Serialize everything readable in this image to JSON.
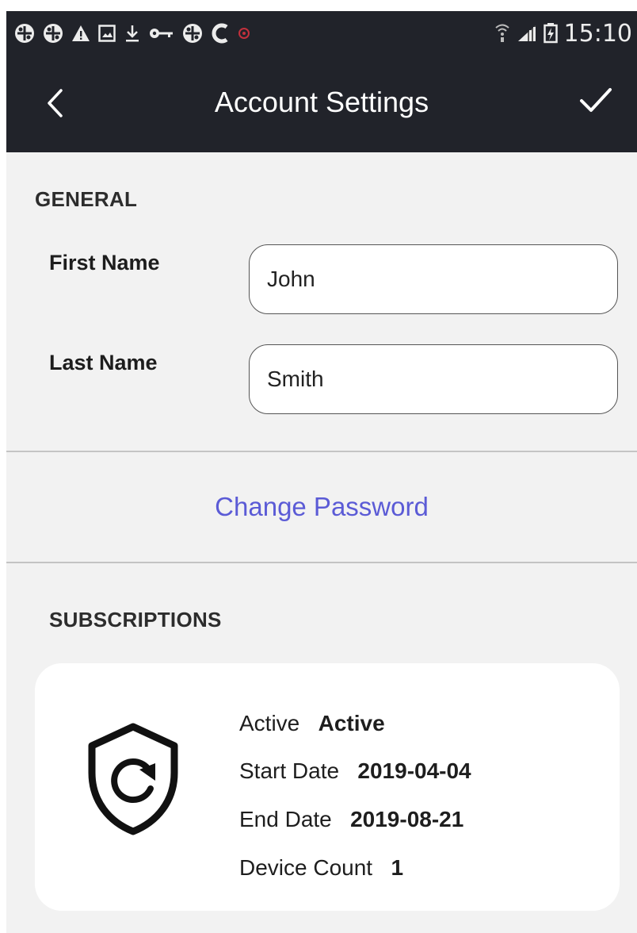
{
  "status_bar": {
    "left_icons": [
      "app-icon",
      "app-icon",
      "warning-icon",
      "image-icon",
      "download-icon",
      "key-icon",
      "app-icon",
      "c-icon",
      "notification-icon"
    ],
    "time": "15:10"
  },
  "app_bar": {
    "title": "Account Settings"
  },
  "general": {
    "heading": "GENERAL",
    "first_name_label": "First Name",
    "first_name_value": "John",
    "last_name_label": "Last Name",
    "last_name_value": "Smith"
  },
  "change_password_label": "Change Password",
  "subscriptions": {
    "heading": "SUBSCRIPTIONS",
    "card": {
      "icon": "shield-refresh-icon",
      "rows": [
        {
          "label": "Active",
          "value": "Active"
        },
        {
          "label": "Start Date",
          "value": "2019-04-04"
        },
        {
          "label": "End Date",
          "value": "2019-08-21"
        },
        {
          "label": "Device Count",
          "value": "1"
        }
      ]
    }
  },
  "colors": {
    "app_bar": "#21232a",
    "background": "#f2f2f2",
    "link": "#5b5bd6"
  }
}
